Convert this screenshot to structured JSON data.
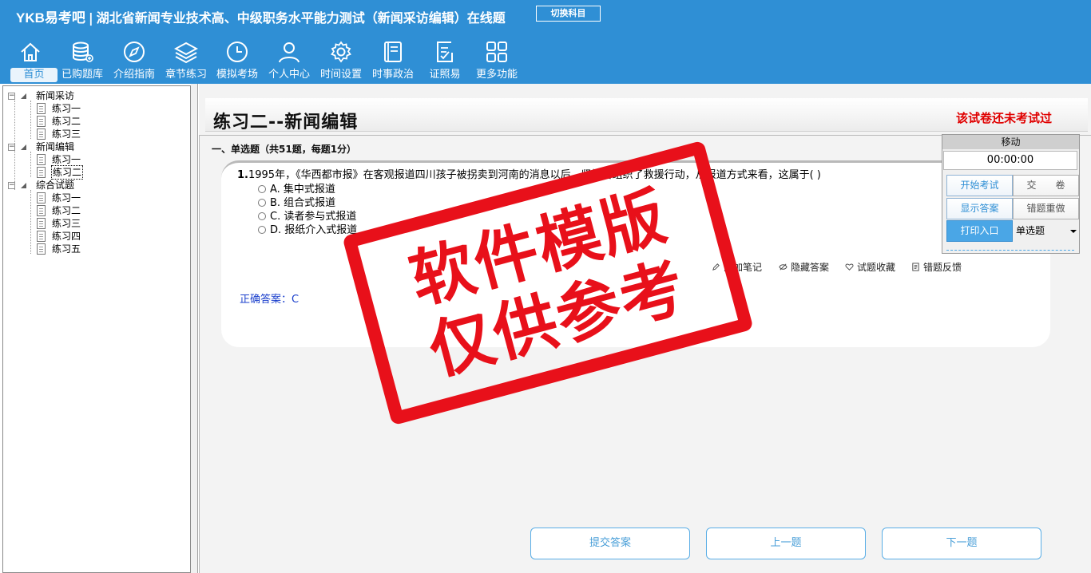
{
  "header": {
    "logo": "YKB易考吧",
    "separator": "|",
    "title": "湖北省新闻专业技术高、中级职务水平能力测试（新闻采访编辑）在线题",
    "switch_label": "切换科目"
  },
  "nav": {
    "items": [
      {
        "label": "首页",
        "icon": "home-icon"
      },
      {
        "label": "已购题库",
        "icon": "database-icon"
      },
      {
        "label": "介绍指南",
        "icon": "compass-icon"
      },
      {
        "label": "章节练习",
        "icon": "layers-icon"
      },
      {
        "label": "模拟考场",
        "icon": "clock-icon"
      },
      {
        "label": "个人中心",
        "icon": "user-icon"
      },
      {
        "label": "时间设置",
        "icon": "gear-icon"
      },
      {
        "label": "时事政治",
        "icon": "book-icon"
      },
      {
        "label": "证照易",
        "icon": "checklist-icon"
      },
      {
        "label": "更多功能",
        "icon": "grid-icon"
      }
    ]
  },
  "tree": {
    "groups": [
      {
        "label": "新闻采访",
        "children": [
          "练习一",
          "练习二",
          "练习三"
        ]
      },
      {
        "label": "新闻编辑",
        "children": [
          "练习一",
          "练习二"
        ]
      },
      {
        "label": "综合试题",
        "children": [
          "练习一",
          "练习二",
          "练习三",
          "练习四",
          "练习五"
        ]
      }
    ],
    "selected": "练习二"
  },
  "main": {
    "page_title": "练习二--新闻编辑",
    "status": "该试卷还未考试过",
    "section_title": "一、单选题（共51题，每题1分）",
    "question": {
      "number": "1.",
      "text": "1995年，《华西都市报》在客观报道四川孩子被拐卖到河南的消息以后，紧接着组织了救援行动，从报道方式来看，这属于( )",
      "options": [
        "A. 集中式报道",
        "B. 组合式报道",
        "C. 读者参与式报道",
        "D. 报纸介入式报道"
      ]
    },
    "tools": {
      "note": "添加笔记",
      "hide_answer": "隐藏答案",
      "favorite": "试题收藏",
      "feedback": "错题反馈"
    },
    "answer": "正确答案：C"
  },
  "panel": {
    "move": "移动",
    "timer": "00:00:00",
    "start_exam": "开始考试",
    "submit_paper": "交　　卷",
    "show_answer": "显示答案",
    "redo_wrong": "错题重做",
    "print": "打印入口",
    "type_select": "单选题"
  },
  "bottom": {
    "submit": "提交答案",
    "prev": "上一题",
    "next": "下一题"
  },
  "watermark": {
    "line1": "软件模版",
    "line2": "仅供参考"
  },
  "colors": {
    "header_bg": "#2f8fd5",
    "status_red": "#e00000",
    "answer_blue": "#1a3fcc",
    "stamp_red": "#e8101a"
  }
}
